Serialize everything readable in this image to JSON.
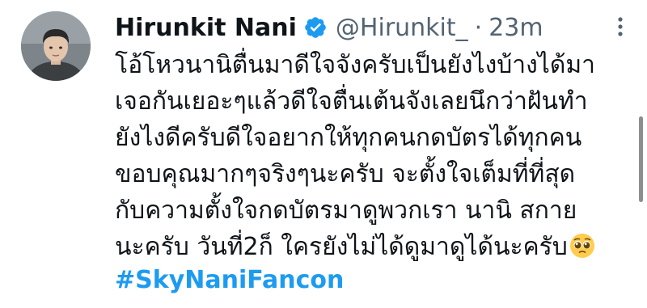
{
  "tweet": {
    "display_name": "Hirunkit Nani",
    "handle": "@Hirunkit_",
    "separator": "·",
    "time": "23m",
    "verified_icon": "verified-badge-icon",
    "avatar_icon": "profile-avatar",
    "more_icon": "more-options-icon",
    "lines": [
      "โอ้โหวนานิตื่นมาดีใจจังครับเป็นยังไงบ้างได้มา",
      "เจอกันเยอะๆแล้วดีใจตื่นเต้นจังเลยนึกว่าฝันทำ",
      "ยังไงดีครับดีใจอยากให้ทุกคนกดบัตรได้ทุกคน",
      "ขอบคุณมากๆจริงๆนะครับ จะตั้งใจเต็มที่ที่สุด",
      "กับความตั้งใจกดบัตรมาดูพวกเรา นานิ สกาย",
      "นะครับ วันที่2ก็ ใครยังไม่ได้ดูมาดูได้นะครับ"
    ],
    "emoji": "pleading-face-emoji",
    "hashtag": "#SkyNaniFancon"
  },
  "colors": {
    "text": "#0f1419",
    "secondary": "#536471",
    "accent": "#1d9bf0",
    "verified": "#1d9bf0"
  }
}
